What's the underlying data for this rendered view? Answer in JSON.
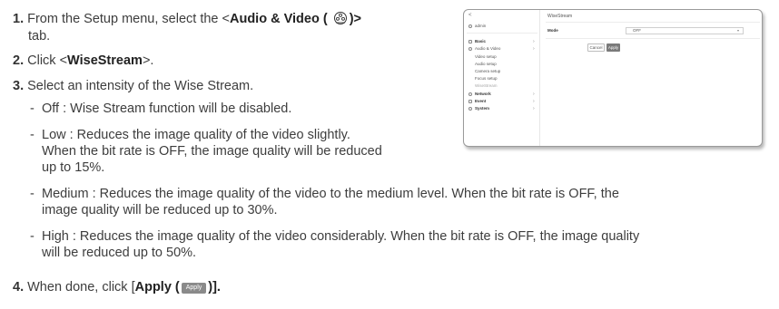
{
  "steps": {
    "s1": {
      "num": "1.",
      "pre": "From the Setup menu, select the <",
      "bold": "Audio & Video (",
      "after_icon": ")>",
      "line2": "tab."
    },
    "s2": {
      "num": "2.",
      "pre": "Click <",
      "bold": "WiseStream",
      "post": ">."
    },
    "s3": {
      "num": "3.",
      "text": "Select an intensity of the Wise Stream."
    },
    "s4": {
      "num": "4.",
      "pre": "When done, click [",
      "bold": "Apply (",
      "chip": "Apply",
      "post": ")]."
    }
  },
  "options": [
    {
      "dash": "-",
      "lines": [
        "Off : Wise Stream function will be disabled."
      ]
    },
    {
      "dash": "-",
      "lines": [
        "Low : Reduces the image quality of the video slightly.",
        "When the bit rate is OFF, the image quality will be reduced",
        "up to 15%."
      ]
    },
    {
      "dash": "-",
      "lines": [
        "Medium : Reduces the image quality of the video to the medium level. When the bit rate is OFF, the",
        "image quality will be reduced up to 30%."
      ]
    },
    {
      "dash": "-",
      "lines": [
        "High : Reduces the image quality of the video considerably. When the bit rate is OFF, the image quality",
        "will be reduced up to 50%."
      ]
    }
  ],
  "screenshot": {
    "back": "<",
    "user": "admin",
    "menu": {
      "basic": "Basic",
      "audio_video": "Audio & Video",
      "video_setup": "Video setup",
      "audio_setup": "Audio setup",
      "camera_setup": "Camera setup",
      "focus_setup": "Focus setup",
      "wisestream": "WiseStream",
      "network": "Network",
      "event": "Event",
      "system": "System"
    },
    "page_title": "WiseStream",
    "mode_label": "Mode",
    "mode_value": "OFF",
    "cancel": "Cancel",
    "apply": "Apply"
  },
  "colors": {
    "text": "#3d3d3d",
    "chip": "#8a8a8a",
    "apply_btn": "#7a7a7a"
  }
}
